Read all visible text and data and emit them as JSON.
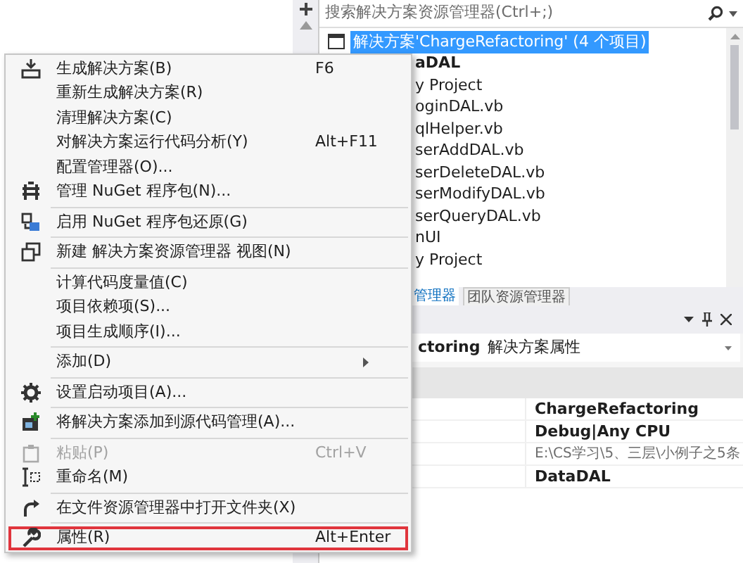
{
  "solution_explorer": {
    "search": {
      "placeholder": "搜索解决方案资源管理器(Ctrl+;)"
    },
    "tree": [
      {
        "label": "解决方案'ChargeRefactoring' (4 个项目)",
        "selected": true,
        "bold": false
      },
      {
        "label": "aDAL",
        "selected": false,
        "bold": true
      },
      {
        "label": "y Project",
        "selected": false,
        "bold": false
      },
      {
        "label": "oginDAL.vb",
        "selected": false,
        "bold": false
      },
      {
        "label": "qlHelper.vb",
        "selected": false,
        "bold": false
      },
      {
        "label": "serAddDAL.vb",
        "selected": false,
        "bold": false
      },
      {
        "label": "serDeleteDAL.vb",
        "selected": false,
        "bold": false
      },
      {
        "label": "serModifyDAL.vb",
        "selected": false,
        "bold": false
      },
      {
        "label": "serQueryDAL.vb",
        "selected": false,
        "bold": false
      },
      {
        "label": "nUI",
        "selected": false,
        "bold": false
      },
      {
        "label": "y Project",
        "selected": false,
        "bold": false
      }
    ],
    "tabs": [
      {
        "label": "管理器",
        "selected": true
      },
      {
        "label": "团队资源管理器",
        "selected": false
      }
    ]
  },
  "properties": {
    "object_name": "ctoring",
    "object_type": "解决方案属性",
    "values": [
      {
        "text": "ChargeRefactoring",
        "bold": true
      },
      {
        "text": "Debug|Any CPU",
        "bold": true
      },
      {
        "text": "E:\\CS学习\\5、三层\\小例子之5条",
        "bold": false
      },
      {
        "text": "DataDAL",
        "bold": true
      }
    ]
  },
  "context_menu": {
    "items": [
      {
        "kind": "item",
        "label": "生成解决方案(B)",
        "shortcut": "F6",
        "disabled": false,
        "submenu": false,
        "selected": false
      },
      {
        "kind": "item",
        "label": "重新生成解决方案(R)",
        "disabled": false,
        "submenu": false,
        "selected": false
      },
      {
        "kind": "item",
        "label": "清理解决方案(C)",
        "disabled": false,
        "submenu": false,
        "selected": false
      },
      {
        "kind": "item",
        "label": "对解决方案运行代码分析(Y)",
        "shortcut": "Alt+F11",
        "disabled": false,
        "submenu": false,
        "selected": false
      },
      {
        "kind": "item",
        "label": "配置管理器(O)...",
        "disabled": false,
        "submenu": false,
        "selected": false
      },
      {
        "kind": "item",
        "label": "管理 NuGet 程序包(N)...",
        "disabled": false,
        "submenu": false,
        "selected": false
      },
      {
        "kind": "separator"
      },
      {
        "kind": "item",
        "label": "启用 NuGet 程序包还原(G)",
        "disabled": false,
        "submenu": false,
        "selected": false
      },
      {
        "kind": "separator"
      },
      {
        "kind": "item",
        "label": "新建 解决方案资源管理器 视图(N)",
        "disabled": false,
        "submenu": false,
        "selected": false
      },
      {
        "kind": "separator"
      },
      {
        "kind": "item",
        "label": "计算代码度量值(C)",
        "disabled": false,
        "submenu": false,
        "selected": false
      },
      {
        "kind": "item",
        "label": "项目依赖项(S)...",
        "disabled": false,
        "submenu": false,
        "selected": false
      },
      {
        "kind": "item",
        "label": "项目生成顺序(I)...",
        "disabled": false,
        "submenu": false,
        "selected": false
      },
      {
        "kind": "separator"
      },
      {
        "kind": "item",
        "label": "添加(D)",
        "disabled": false,
        "submenu": true,
        "selected": false
      },
      {
        "kind": "separator"
      },
      {
        "kind": "item",
        "label": "设置启动项目(A)...",
        "disabled": false,
        "submenu": false,
        "selected": false
      },
      {
        "kind": "separator"
      },
      {
        "kind": "item",
        "label": "将解决方案添加到源代码管理(A)...",
        "disabled": false,
        "submenu": false,
        "selected": false
      },
      {
        "kind": "separator"
      },
      {
        "kind": "item",
        "label": "粘贴(P)",
        "shortcut": "Ctrl+V",
        "disabled": true,
        "submenu": false,
        "selected": false
      },
      {
        "kind": "item",
        "label": "重命名(M)",
        "disabled": false,
        "submenu": false,
        "selected": false
      },
      {
        "kind": "separator"
      },
      {
        "kind": "item",
        "label": "在文件资源管理器中打开文件夹(X)",
        "disabled": false,
        "submenu": false,
        "selected": false
      },
      {
        "kind": "separator"
      },
      {
        "kind": "item",
        "label": "属性(R)",
        "shortcut": "Alt+Enter",
        "disabled": false,
        "submenu": false,
        "selected": true
      }
    ]
  }
}
